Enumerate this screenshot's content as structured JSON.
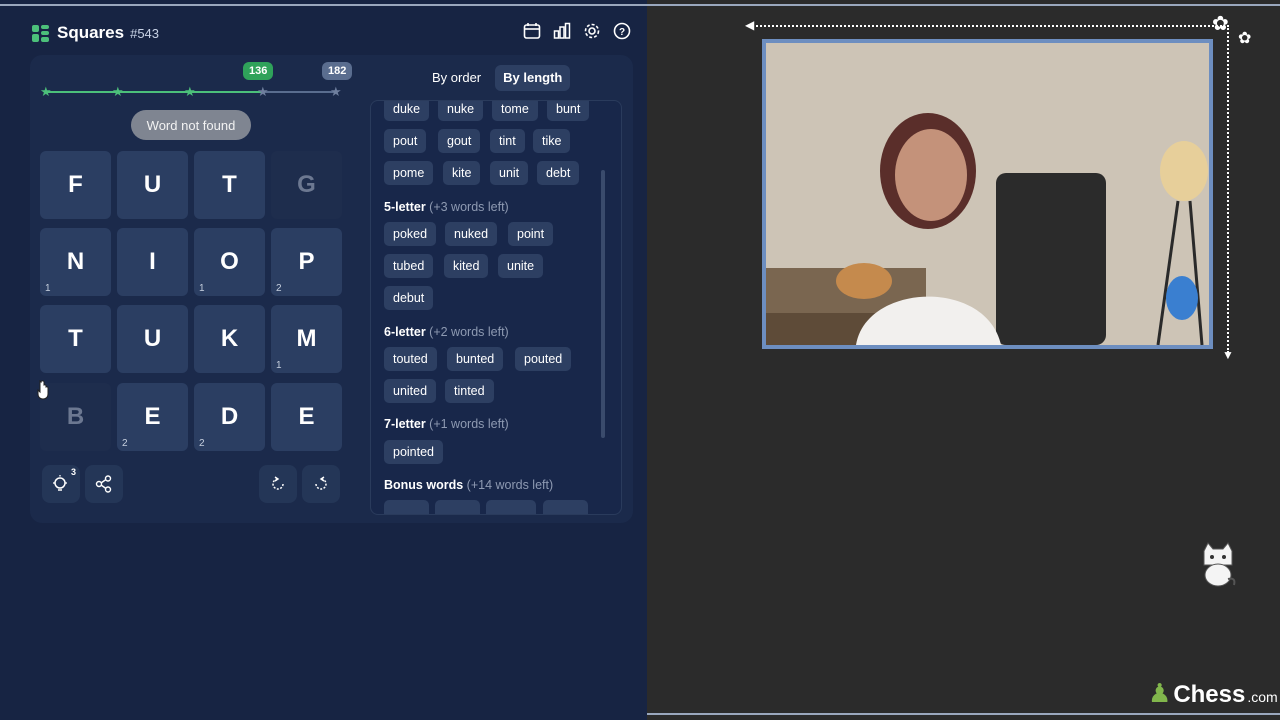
{
  "app": {
    "title": "Squares",
    "number": "#543"
  },
  "header_icons": [
    "calendar-icon",
    "stats-icon",
    "gear-icon",
    "help-icon"
  ],
  "progress": {
    "badge_current": "136",
    "badge_max": "182",
    "fraction": 0.75
  },
  "toast": "Word not found",
  "tabs": {
    "by_order": "By order",
    "by_length": "By length"
  },
  "grid": [
    [
      "F",
      "U",
      "T",
      "G"
    ],
    [
      "N",
      "I",
      "O",
      "P"
    ],
    [
      "T",
      "U",
      "K",
      "M"
    ],
    [
      "B",
      "E",
      "D",
      "E"
    ]
  ],
  "counts": {
    "n": "1",
    "o": "1",
    "p": "2",
    "m": "1",
    "e": "2",
    "d": "2"
  },
  "hint_count": "3",
  "words": {
    "cut_row": [
      "duke",
      "nuke",
      "tome",
      "bunt"
    ],
    "four": [
      "pout",
      "gout",
      "tint",
      "tike",
      "pome",
      "kite",
      "unit",
      "debt"
    ],
    "five_label": "5-letter",
    "five_left": "(+3 words left)",
    "five": [
      "poked",
      "nuked",
      "point",
      "tubed",
      "kited",
      "unite",
      "debut"
    ],
    "six_label": "6-letter",
    "six_left": "(+2 words left)",
    "six": [
      "touted",
      "bunted",
      "pouted",
      "united",
      "tinted"
    ],
    "seven_label": "7-letter",
    "seven_left": "(+1 words left)",
    "seven": [
      "pointed"
    ],
    "bonus_label": "Bonus words",
    "bonus_left": "(+14 words left)"
  },
  "brand": {
    "name": "Chess",
    "suffix": ".com"
  },
  "colors": {
    "accent_green": "#4cc07a",
    "badge_gray": "#5a6d8f",
    "bg": "#172443",
    "tile": "#2b3e62"
  }
}
